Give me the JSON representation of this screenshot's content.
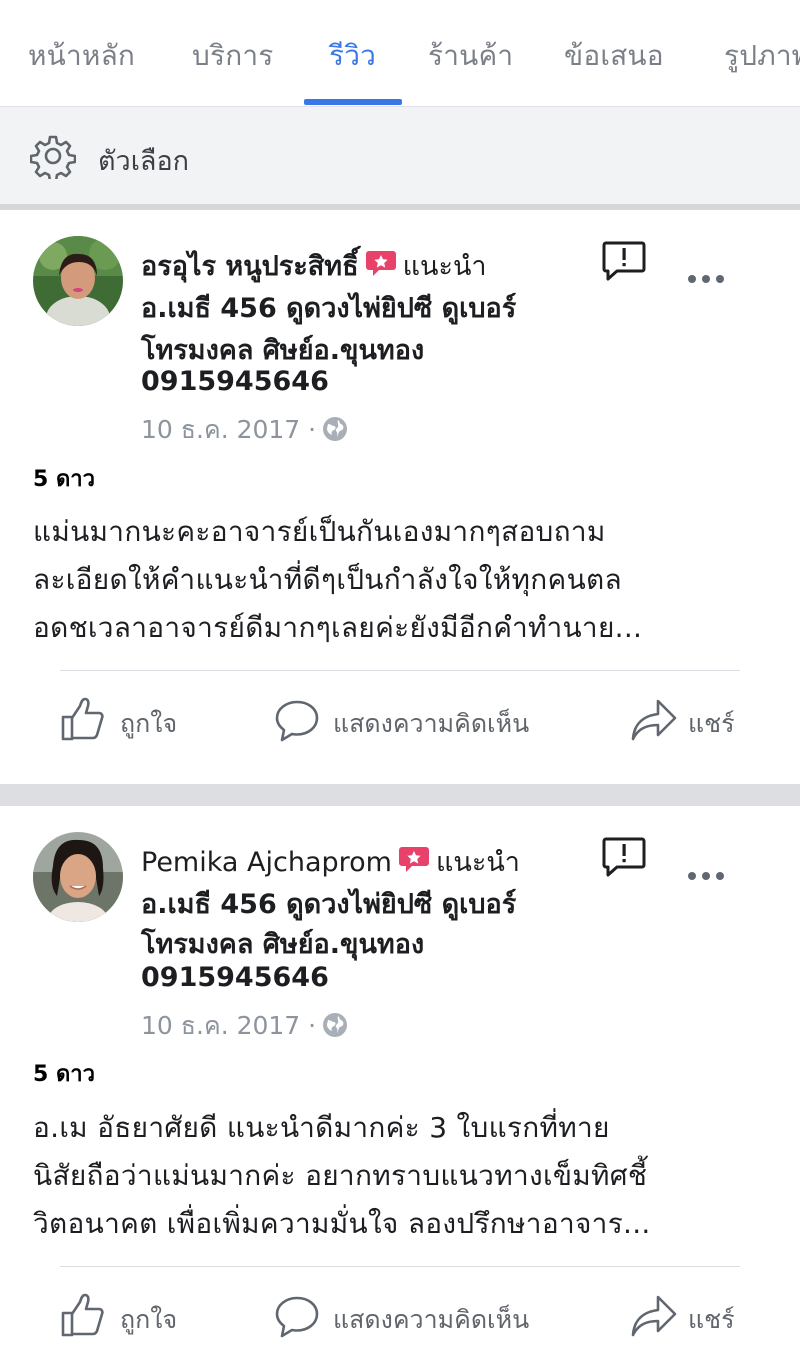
{
  "tabs": [
    {
      "label": "หน้าหลัก",
      "active": false
    },
    {
      "label": "บริการ",
      "active": false
    },
    {
      "label": "รีวิว",
      "active": true
    },
    {
      "label": "ร้านค้า",
      "active": false
    },
    {
      "label": "ข้อเสนอ",
      "active": false
    },
    {
      "label": "รูปภาพ",
      "active": false
    }
  ],
  "options": {
    "label": "ตัวเลือก",
    "icon": "gear-icon"
  },
  "reviews": [
    {
      "author": "อรอุไร หนูประสิทธิ์",
      "recommend_label": "แนะนำ",
      "page_lines": [
        "อ.เมธี 456 ดูดวงไพ่ยิปซี ดูเบอร์",
        "โทรมงคล ศิษย์อ.ขุนทอง",
        "0915945646"
      ],
      "date": "10 ธ.ค. 2017",
      "date_sep": "·",
      "stars": "5 ดาว",
      "text_lines": [
        "แม่นมากนะคะอาจารย์เป็นกันเองมากๆสอบถาม",
        "ละเอียดให้คำแนะนำที่ดีๆเป็นกำลังใจให้ทุกคนตล",
        "อดชเวลาอาจารย์ดีมากๆเลยค่ะยังมีอีกคำทำนาย..."
      ],
      "actions": {
        "like": "ถูกใจ",
        "comment": "แสดงความคิดเห็น",
        "share": "แชร์"
      }
    },
    {
      "author": "Pemika Ajchaprom",
      "recommend_label": "แนะนำ",
      "page_lines": [
        "อ.เมธี 456 ดูดวงไพ่ยิปซี ดูเบอร์",
        "โทรมงคล ศิษย์อ.ขุนทอง",
        "0915945646"
      ],
      "date": "10 ธ.ค. 2017",
      "date_sep": "·",
      "stars": "5 ดาว",
      "text_lines": [
        "อ.เม อัธยาศัยดี แนะนำดีมากค่ะ 3 ใบแรกที่ทาย",
        "นิสัยถือว่าแม่นมากค่ะ อยากทราบแนวทางเข็มทิศชี้",
        "วิตอนาคต เพื่อเพิ่มความมั่นใจ ลองปรึกษาอาจาร..."
      ],
      "actions": {
        "like": "ถูกใจ",
        "comment": "แสดงความคิดเห็น",
        "share": "แชร์"
      }
    }
  ],
  "colors": {
    "accent": "#3b78e7",
    "badge": "#e9426a",
    "muted": "#8d949e"
  }
}
